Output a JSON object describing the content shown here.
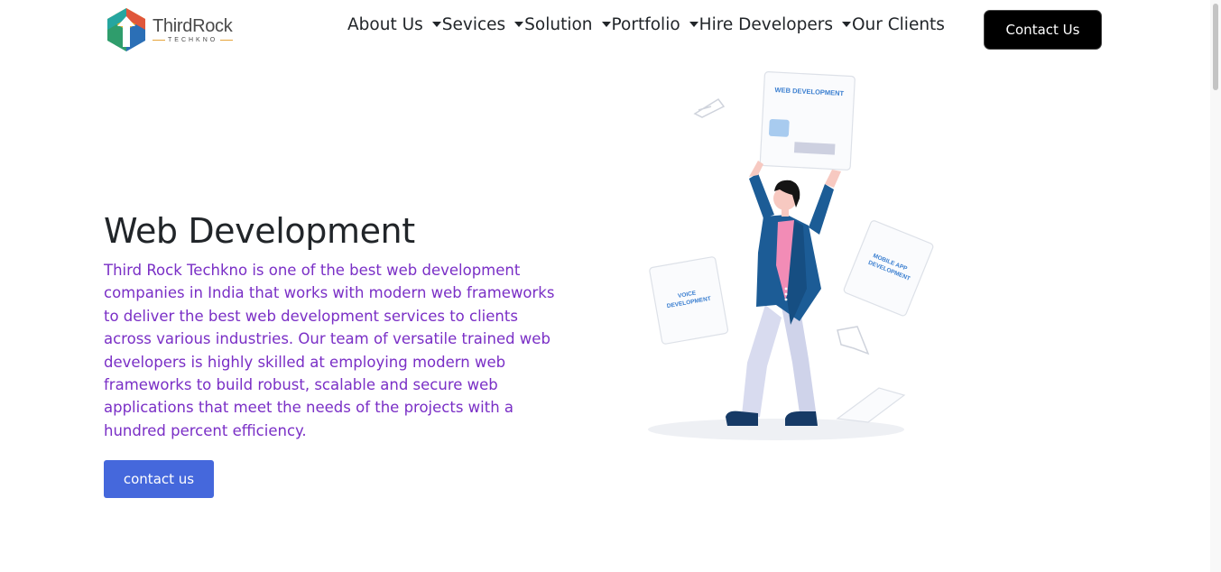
{
  "brand": {
    "name": "ThirdRock",
    "sub": "TECHKNO"
  },
  "nav": {
    "items": [
      {
        "label": "About Us",
        "has_dropdown": true
      },
      {
        "label": "Sevices",
        "has_dropdown": true
      },
      {
        "label": "Solution",
        "has_dropdown": true
      },
      {
        "label": "Portfolio",
        "has_dropdown": true
      },
      {
        "label": "Hire Developers",
        "has_dropdown": true
      },
      {
        "label": "Our Clients",
        "has_dropdown": false
      }
    ],
    "contact_button": "Contact Us"
  },
  "hero": {
    "title": "Web Development",
    "description": "Third Rock Techkno is one of the best web development companies in India that works with modern web frameworks to deliver the best web development services to clients across various industries. Our team of versatile trained web developers is highly skilled at employing modern web frameworks to build robust, scalable and secure web applications that meet the needs of the projects with a hundred percent efficiency.",
    "button": "contact us"
  },
  "illustration": {
    "card_main": "WEB DEVELOPMENT",
    "card_left_line1": "VOICE",
    "card_left_line2": "DEVELOPMENT",
    "card_right_line1": "MOBILE APP",
    "card_right_line2": "DEVELOPMENT"
  },
  "colors": {
    "primary_button": "#4568dc",
    "description_text": "#7a2fc6",
    "contact_button_bg": "#000000",
    "jacket": "#1c5c96",
    "shirt": "#f28cb6"
  }
}
